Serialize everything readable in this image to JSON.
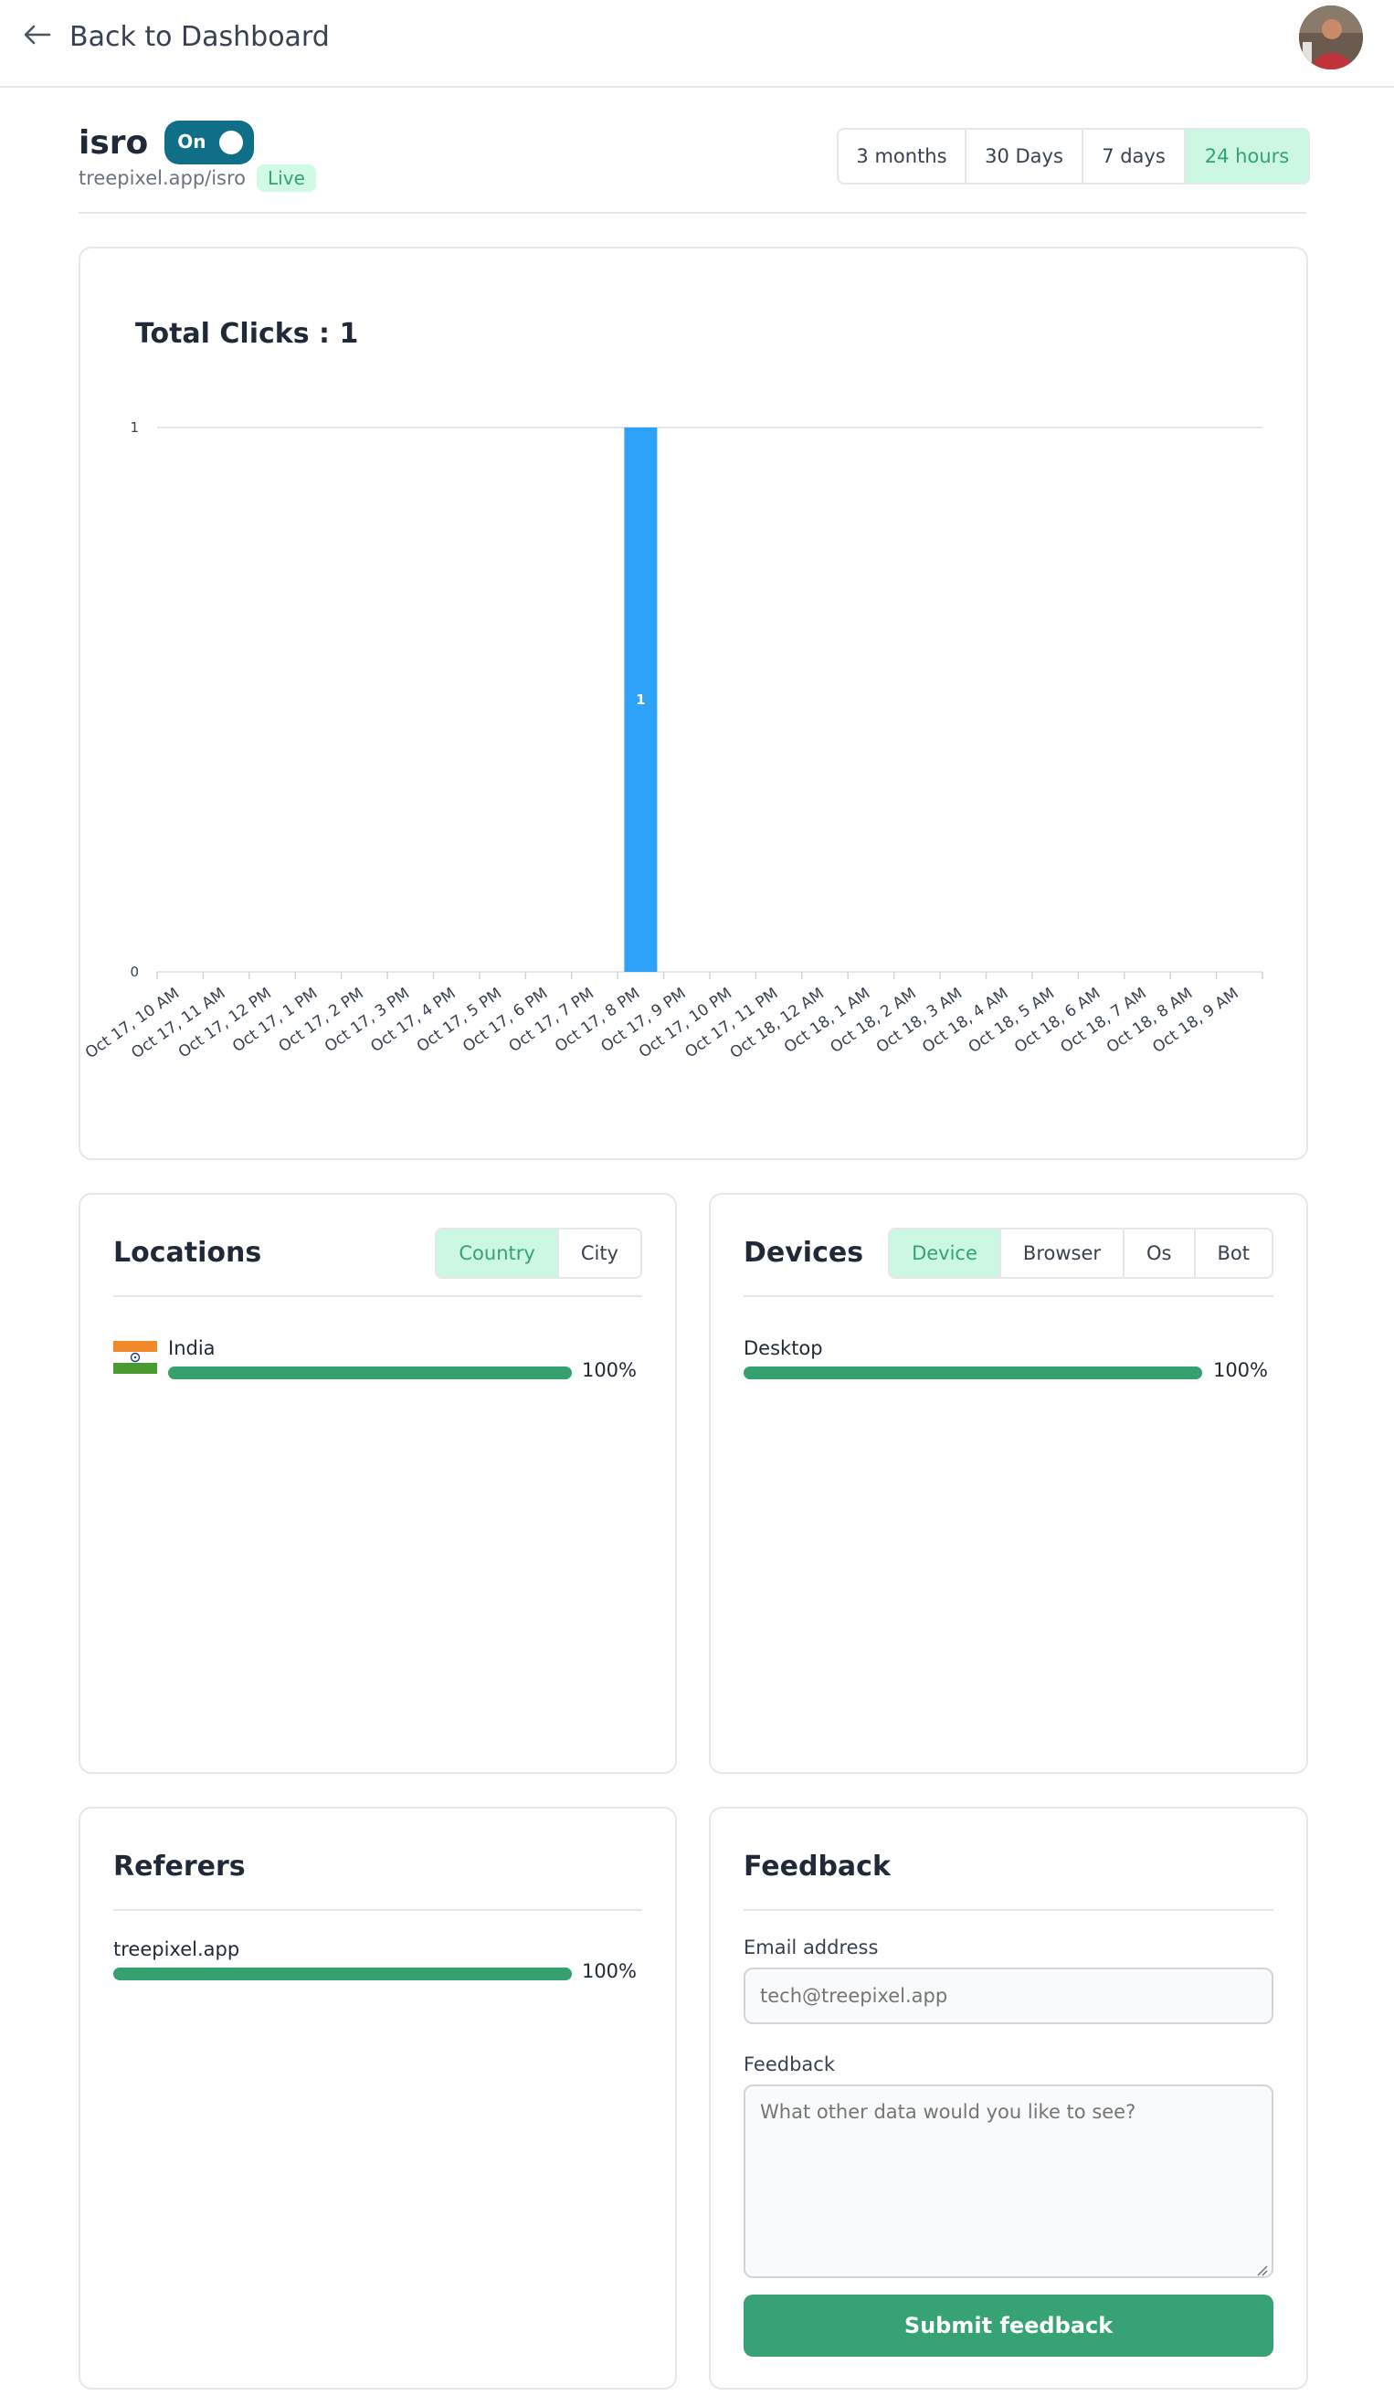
{
  "header": {
    "back_label": "Back to Dashboard"
  },
  "link": {
    "name": "isro",
    "toggle_label": "On",
    "url": "treepixel.app/isro",
    "status_badge": "Live"
  },
  "ranges": [
    {
      "label": "3 months",
      "active": false
    },
    {
      "label": "30 Days",
      "active": false
    },
    {
      "label": "7 days",
      "active": false
    },
    {
      "label": "24 hours",
      "active": true
    }
  ],
  "chart_data": {
    "type": "bar",
    "title": "Total Clicks : 1",
    "categories": [
      "Oct 17, 10 AM",
      "Oct 17, 11 AM",
      "Oct 17, 12 PM",
      "Oct 17, 1 PM",
      "Oct 17, 2 PM",
      "Oct 17, 3 PM",
      "Oct 17, 4 PM",
      "Oct 17, 5 PM",
      "Oct 17, 6 PM",
      "Oct 17, 7 PM",
      "Oct 17, 8 PM",
      "Oct 17, 9 PM",
      "Oct 17, 10 PM",
      "Oct 17, 11 PM",
      "Oct 18, 12 AM",
      "Oct 18, 1 AM",
      "Oct 18, 2 AM",
      "Oct 18, 3 AM",
      "Oct 18, 4 AM",
      "Oct 18, 5 AM",
      "Oct 18, 6 AM",
      "Oct 18, 7 AM",
      "Oct 18, 8 AM",
      "Oct 18, 9 AM"
    ],
    "values": [
      0,
      0,
      0,
      0,
      0,
      0,
      0,
      0,
      0,
      0,
      1,
      0,
      0,
      0,
      0,
      0,
      0,
      0,
      0,
      0,
      0,
      0,
      0,
      0
    ],
    "ylim": [
      0,
      1
    ],
    "yticks": [
      "0",
      "1"
    ],
    "bar_color": "#2ea1f8",
    "show_data_labels": true
  },
  "locations": {
    "title": "Locations",
    "tabs": [
      {
        "label": "Country",
        "active": true
      },
      {
        "label": "City",
        "active": false
      }
    ],
    "items": [
      {
        "label": "India",
        "percent": "100%",
        "fraction": 1.0,
        "flag": "india-flag-icon"
      }
    ]
  },
  "devices": {
    "title": "Devices",
    "tabs": [
      {
        "label": "Device",
        "active": true
      },
      {
        "label": "Browser",
        "active": false
      },
      {
        "label": "Os",
        "active": false
      },
      {
        "label": "Bot",
        "active": false
      }
    ],
    "items": [
      {
        "label": "Desktop",
        "percent": "100%",
        "fraction": 1.0
      }
    ]
  },
  "referers": {
    "title": "Referers",
    "items": [
      {
        "label": "treepixel.app",
        "percent": "100%",
        "fraction": 1.0
      }
    ]
  },
  "feedback": {
    "title": "Feedback",
    "email_label": "Email address",
    "email_placeholder": "tech@treepixel.app",
    "feedback_label": "Feedback",
    "feedback_placeholder": "What other data would you like to see?",
    "submit_label": "Submit feedback"
  },
  "colors": {
    "accent_green": "#37a274",
    "active_tab_bg": "#ccf7e3",
    "toggle_bg": "#0f6f86",
    "bar_blue": "#2ea1f8"
  }
}
